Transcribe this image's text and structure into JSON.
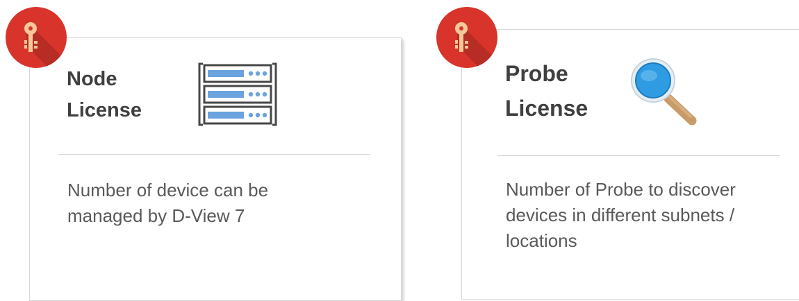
{
  "cards": [
    {
      "title_line1": "Node",
      "title_line2": "License",
      "description": "Number of device can be\nmanaged by D-View 7",
      "badge_icon": "key-icon",
      "feature_icon": "server-rack-icon"
    },
    {
      "title_line1": "Probe",
      "title_line2": "License",
      "description": "Number of Probe to discover\ndevices in different subnets /\nlocations",
      "badge_icon": "key-icon",
      "feature_icon": "magnifier-icon"
    }
  ],
  "colors": {
    "badge": "#d9342b",
    "title": "#3f3f3f",
    "description": "#595959",
    "server_bar": "#6aa3dd",
    "magnifier_lens": "#2e9be3",
    "magnifier_handle": "#c89b68"
  }
}
